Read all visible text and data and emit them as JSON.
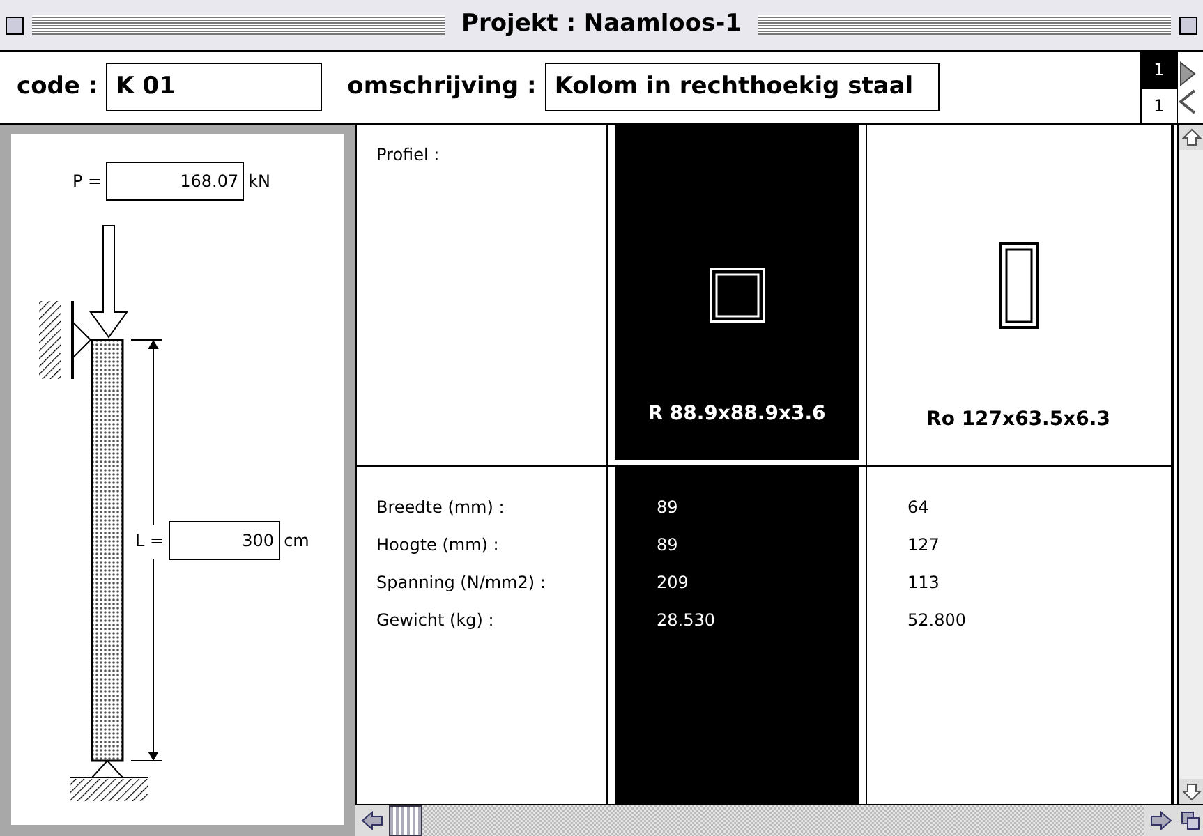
{
  "window": {
    "title": "Projekt : Naamloos-1"
  },
  "header": {
    "code_label": "code :",
    "code": "K 01",
    "description_label": "omschrijving :",
    "description": "Kolom in rechthoekig staal",
    "pages": [
      {
        "label": "1",
        "selected": true
      },
      {
        "label": "1",
        "selected": false
      }
    ]
  },
  "column_diagram": {
    "load_label": "P =",
    "load": "168.07",
    "load_unit": "kN",
    "length_label": "L =",
    "length": "300",
    "length_unit": "cm"
  },
  "table": {
    "profile_label": "Profiel :",
    "row_labels": [
      "Breedte (mm) :",
      "Hoogte (mm) :",
      "Spanning (N/mm2) :",
      "Gewicht (kg) :"
    ],
    "profiles": [
      {
        "name": "R 88.9x88.9x3.6",
        "kind": "square",
        "selected": true,
        "values": [
          "89",
          "89",
          "209",
          "28.530"
        ]
      },
      {
        "name": "Ro 127x63.5x6.3",
        "kind": "rectangle",
        "selected": false,
        "values": [
          "64",
          "127",
          "113",
          "52.800"
        ]
      }
    ]
  }
}
